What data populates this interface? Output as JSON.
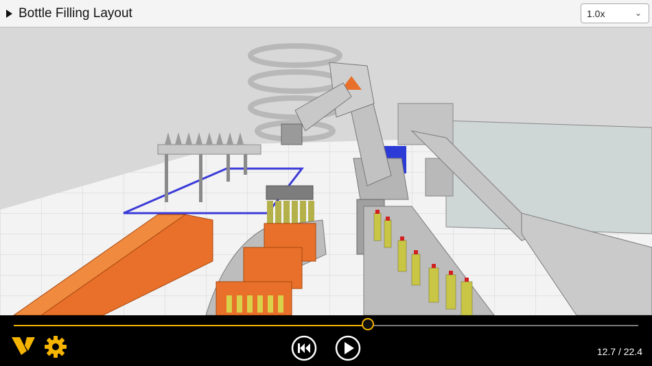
{
  "header": {
    "title": "Bottle Filling Layout",
    "speed": {
      "selected": "1.0x"
    }
  },
  "playback": {
    "current": 12.7,
    "total": 22.4,
    "time_label": "12.7 / 22.4"
  },
  "colors": {
    "accent": "#f5b400",
    "control_bar": "#000000",
    "header_bg": "#f4f4f4",
    "crate_orange": "#e8702a",
    "floor": "#f0f0f0"
  },
  "icons": {
    "expand": "play-triangle-icon",
    "speed_dropdown": "chevron-down-icon",
    "logo": "brand-v-logo",
    "settings": "gear-icon",
    "restart": "skip-back-icon",
    "play": "play-icon"
  }
}
